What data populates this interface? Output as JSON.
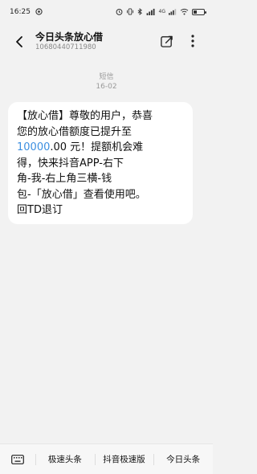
{
  "status_bar": {
    "time": "16:25",
    "network_label": "4G",
    "battery_label": "3",
    "battery_level": 0.3
  },
  "header": {
    "title": "今日头条放心借",
    "number": "10680440711980"
  },
  "conversation": {
    "date_label": "短信",
    "time": "16-02"
  },
  "message": {
    "lines": [
      "【放心借】尊敬的用户，恭喜",
      "您的放心借额度已提升至",
      "",
      "得，快来抖音APP-右下",
      "角-我-右上角三横-钱",
      "包-「放心借」查看使用吧。",
      "回TD退订"
    ],
    "amount": "10000",
    "amount_rest": ".00 元！提额机会难"
  },
  "bottom_menu": {
    "items": [
      "极速头条",
      "抖音极速版",
      "今日头条"
    ]
  },
  "colors": {
    "link": "#3d8fe0",
    "background": "#f2f2f2",
    "bubble": "#ffffff"
  }
}
